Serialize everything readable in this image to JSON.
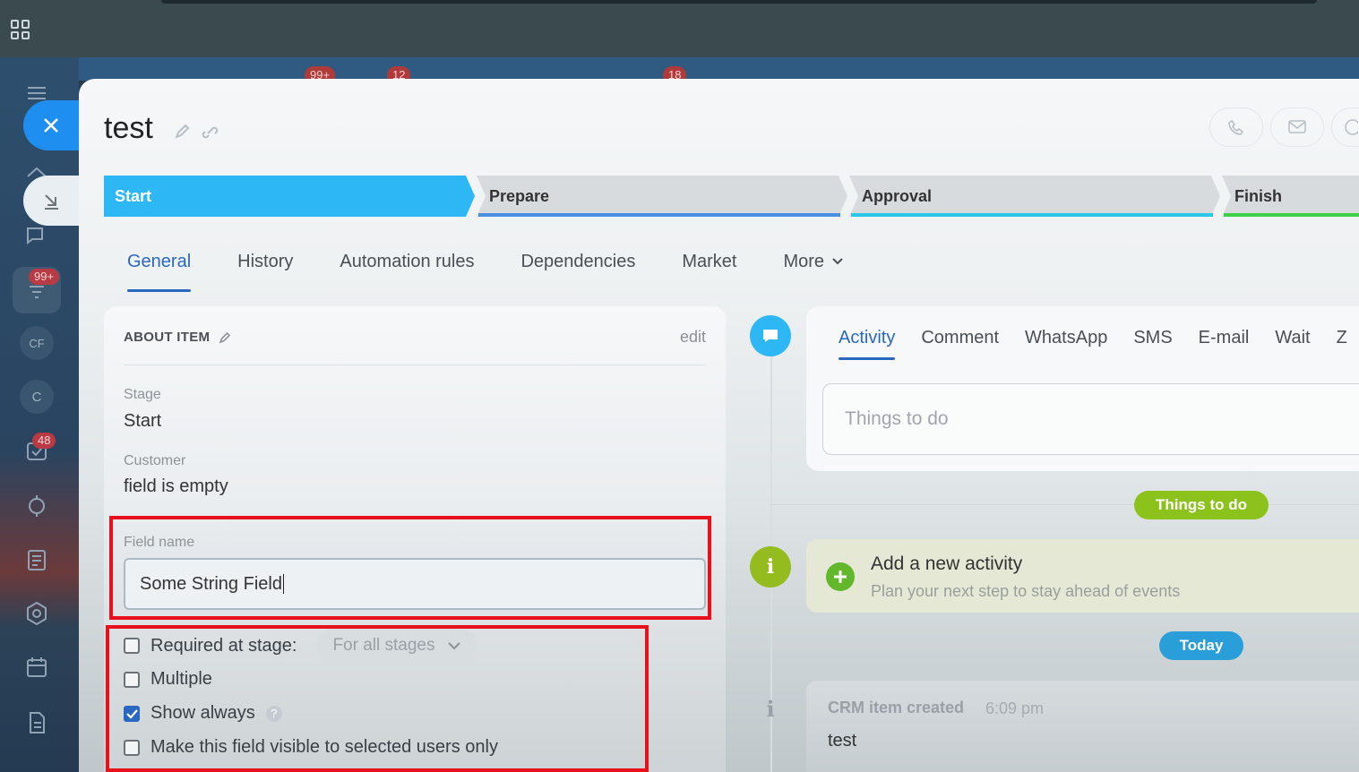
{
  "item": {
    "title": "test"
  },
  "bg_badges": [
    "99+",
    "12",
    "18"
  ],
  "sidebar": {
    "badges": {
      "feed": "99+",
      "tasks": "48"
    },
    "labels": {
      "cf": "CF",
      "c": "C"
    }
  },
  "stages": [
    {
      "label": "Start",
      "color": "#2eb7f5",
      "state": "active"
    },
    {
      "label": "Prepare",
      "color": "#4a90e2"
    },
    {
      "label": "Approval",
      "color": "#29c8e8"
    },
    {
      "label": "Finish",
      "color": "#3ad04a"
    }
  ],
  "tabs": {
    "general": "General",
    "history": "History",
    "automation": "Automation rules",
    "dependencies": "Dependencies",
    "market": "Market",
    "more": "More"
  },
  "about": {
    "title": "ABOUT ITEM",
    "edit": "edit",
    "stage_label": "Stage",
    "stage_value": "Start",
    "customer_label": "Customer",
    "customer_value": "field is empty",
    "field_name_label": "Field name",
    "field_name_value": "Some String Field",
    "required_label": "Required at stage:",
    "required_select": "For all stages",
    "multiple_label": "Multiple",
    "show_always_label": "Show always",
    "show_always_checked": true,
    "visible_selected_label": "Make this field visible to selected users only",
    "help": "?"
  },
  "activity": {
    "tabs": {
      "activity": "Activity",
      "comment": "Comment",
      "whatsapp": "WhatsApp",
      "sms": "SMS",
      "email": "E-mail",
      "wait": "Wait",
      "cut": "Z"
    },
    "todo_placeholder": "Things to do",
    "todo_pill": "Things to do",
    "new_title": "Add a new activity",
    "new_sub": "Plan your next step to stay ahead of events",
    "today_pill": "Today",
    "crm_title": "CRM item created",
    "crm_time": "6:09 pm",
    "crm_text": "test"
  },
  "colors": {
    "accent": "#2a67c0",
    "start_stage": "#2eb7f5",
    "highlight": "#e8101a",
    "todo_pill": "#8cc21c",
    "today_pill": "#2a9ed8"
  }
}
